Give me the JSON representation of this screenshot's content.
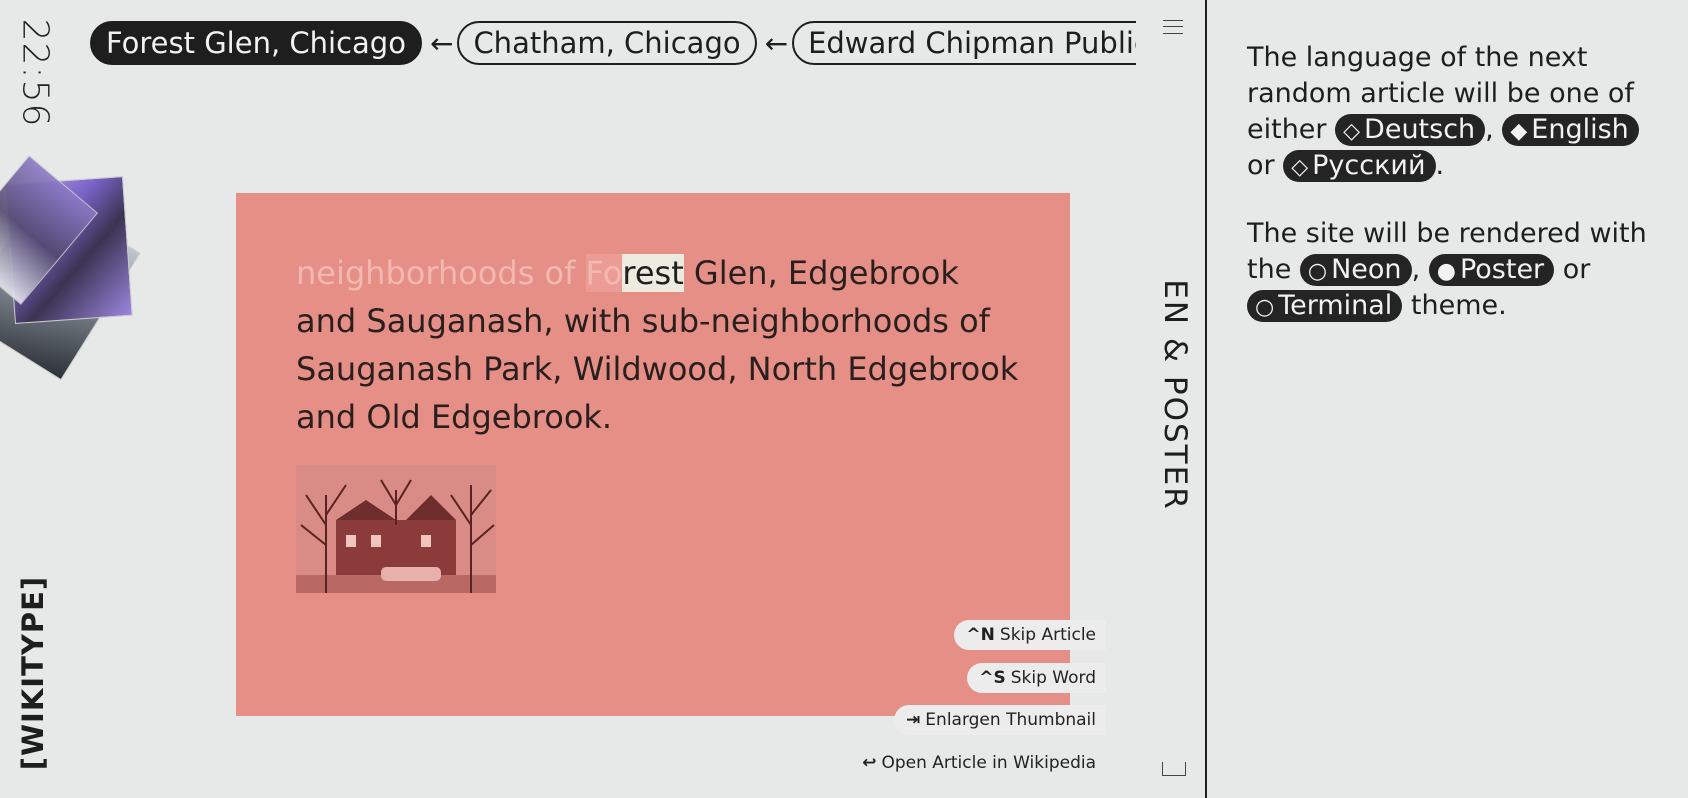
{
  "clock": {
    "time": "22:56"
  },
  "logo": {
    "text": "[WIKITYPE]"
  },
  "breadcrumbs": [
    {
      "label": "Forest Glen, Chicago",
      "active": true
    },
    {
      "label": "Chatham, Chicago",
      "active": false
    },
    {
      "label": "Edward Chipman Public Library",
      "active": false
    }
  ],
  "breadcrumb_arrow": "←",
  "theme_label": "EN & POSTER",
  "article": {
    "typed": "neighborhoods of ",
    "typed_partial": "Fo",
    "current": "rest",
    "remaining": " Glen, Edgebrook and Sauganash, with sub-neighborhoods of Sauganash Park, Wildwood, North Edgebrook and Old Edgebrook."
  },
  "colors": {
    "card": "#e58f86",
    "background": "#e7e9e8",
    "pill": "#242424"
  },
  "shortcuts": [
    {
      "key": "^N",
      "label": "Skip Article"
    },
    {
      "key": "^S",
      "label": "Skip Word"
    },
    {
      "key": "⇥",
      "label": "Enlargen Thumbnail"
    },
    {
      "key": "↩",
      "label": "Open Article in Wikipedia"
    }
  ],
  "panel": {
    "lang_intro": "The language of the next random article will be one of either",
    "languages": [
      {
        "icon": "◇",
        "label": "Deutsch"
      },
      {
        "icon": "◆",
        "label": "English"
      },
      {
        "icon": "◇",
        "label": "Русский"
      }
    ],
    "sep_comma": ",",
    "sep_or": "or",
    "end_dot": ".",
    "theme_intro": "The site will be rendered with the",
    "themes": [
      {
        "icon": "○",
        "label": "Neon"
      },
      {
        "icon": "●",
        "label": "Poster"
      },
      {
        "icon": "○",
        "label": "Terminal"
      }
    ],
    "theme_outro": "theme."
  }
}
